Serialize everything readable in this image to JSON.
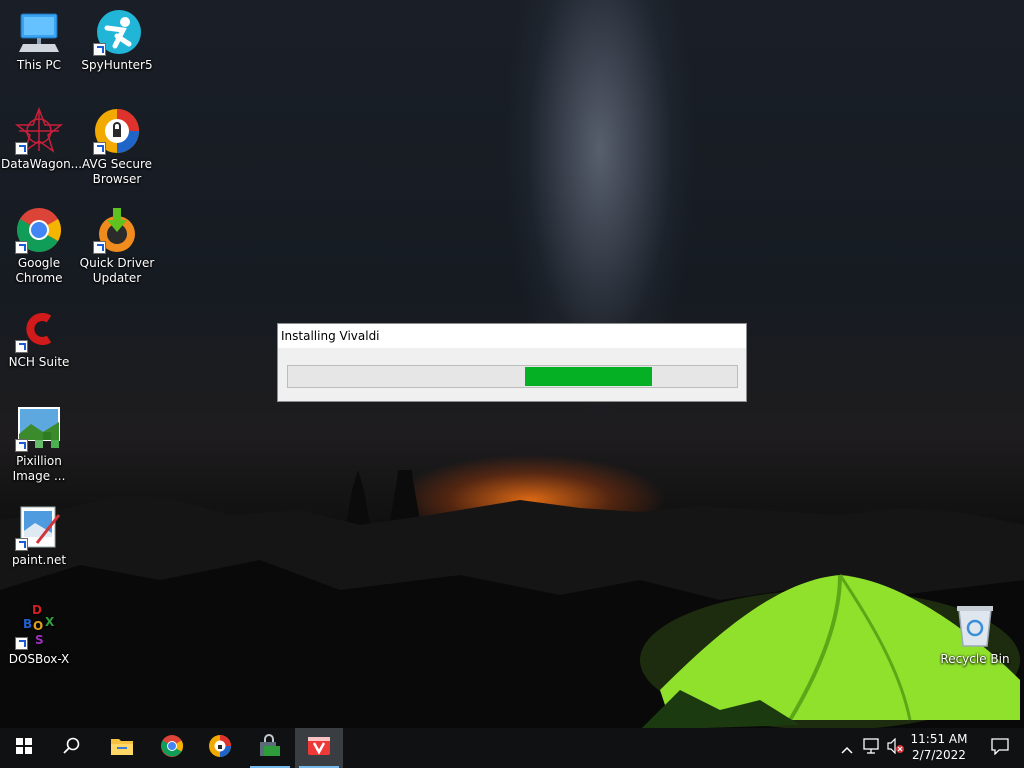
{
  "desktop": {
    "icons": [
      {
        "label": "This PC"
      },
      {
        "label": "SpyHunter5"
      },
      {
        "label": "DataWagon..."
      },
      {
        "label": "AVG Secure Browser"
      },
      {
        "label": "Google Chrome"
      },
      {
        "label": "Quick Driver Updater"
      },
      {
        "label": "NCH Suite"
      },
      {
        "label": "Pixillion Image ..."
      },
      {
        "label": "paint.net"
      },
      {
        "label": "DOSBox-X"
      },
      {
        "label": "Recycle Bin"
      }
    ]
  },
  "installer": {
    "title": "Installing Vivaldi",
    "progress_state": "indeterminate (marquee)",
    "progress_color": "#06b025"
  },
  "taskbar": {
    "buttons": [
      {
        "icon": "windows-start-icon"
      },
      {
        "icon": "search-icon"
      },
      {
        "icon": "file-explorer-icon"
      },
      {
        "icon": "chrome-icon"
      },
      {
        "icon": "avg-browser-icon"
      },
      {
        "icon": "installer-lock-icon"
      },
      {
        "icon": "vivaldi-icon"
      }
    ],
    "clock": {
      "time": "11:51 AM",
      "date": "2/7/2022"
    },
    "tray": [
      "chevron-up-icon",
      "network-icon",
      "volume-muted-icon",
      "notifications-icon"
    ]
  },
  "colors": {
    "taskbar": "#101113",
    "progress_fill": "#06b025",
    "running_indicator": "#76b9ed"
  }
}
